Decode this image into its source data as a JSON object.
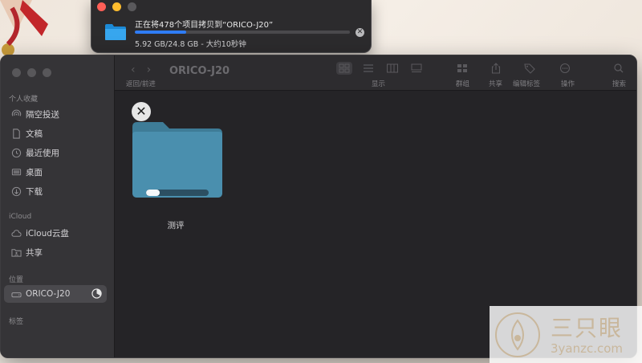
{
  "copy_dialog": {
    "title": "正在将478个项目拷贝到“ORICO-J20”",
    "progress": 0.24,
    "status": "5.92 GB/24.8 GB - 大约10秒钟"
  },
  "finder": {
    "window_title": "ORICO-J20",
    "toolbar": {
      "nav_label": "返回/前进",
      "view_label": "显示",
      "group_label": "群组",
      "share_label": "共享",
      "tags_label": "编辑标签",
      "action_label": "操作",
      "search_label": "搜索"
    },
    "sidebar": {
      "favorites_header": "个人收藏",
      "favorites": [
        {
          "label": "隔空投送",
          "icon": "airdrop-icon"
        },
        {
          "label": "文稿",
          "icon": "document-icon"
        },
        {
          "label": "最近使用",
          "icon": "clock-icon"
        },
        {
          "label": "桌面",
          "icon": "desktop-icon"
        },
        {
          "label": "下载",
          "icon": "download-icon"
        }
      ],
      "icloud_header": "iCloud",
      "icloud": [
        {
          "label": "iCloud云盘",
          "icon": "cloud-icon"
        },
        {
          "label": "共享",
          "icon": "shared-folder-icon"
        }
      ],
      "locations_header": "位置",
      "locations": [
        {
          "label": "ORICO-J20",
          "icon": "drive-icon"
        }
      ],
      "tags_header": "标签"
    },
    "content": {
      "item_name": "测评",
      "item_progress": 0.22
    }
  },
  "watermark": {
    "text": "三只眼",
    "url": "3yanzc.com"
  },
  "colors": {
    "accent": "#2f7cf6",
    "folder": "#4a90b0",
    "window_bg": "#252427",
    "sidebar_bg": "#353437"
  }
}
